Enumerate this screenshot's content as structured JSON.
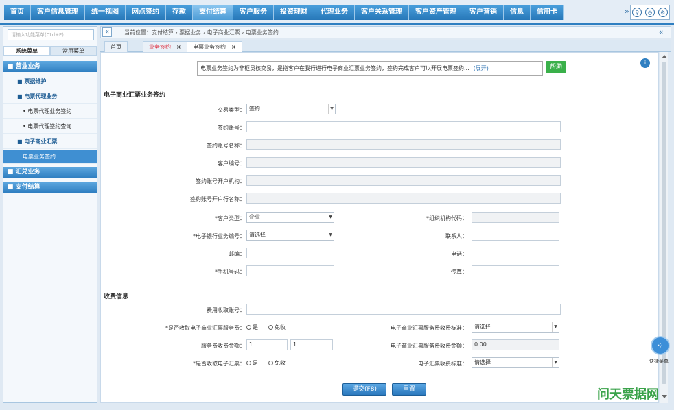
{
  "nav": {
    "items": [
      "首页",
      "客户信息管理",
      "统一视图",
      "网点签约",
      "存款",
      "支付结算",
      "客户服务",
      "投资理财",
      "代理业务",
      "客户关系管理",
      "客户资产管理",
      "客户营销",
      "信息",
      "信用卡"
    ],
    "more": "»",
    "icons": [
      "search-icon",
      "clock-icon",
      "gear-icon"
    ]
  },
  "sidebar": {
    "search_placeholder": "请输入功能菜单(Ctrl+F)",
    "tabs": [
      "系统菜单",
      "常用菜单"
    ],
    "sections": [
      {
        "label": "■ 营业业务"
      }
    ],
    "items": [
      {
        "label": "■ 票据维护",
        "level": "l1"
      },
      {
        "label": "■ 电票代理业务",
        "level": "l1"
      },
      {
        "label": "• 电票代理业务签约",
        "level": "l2"
      },
      {
        "label": "• 电票代理签约查询",
        "level": "l2"
      },
      {
        "label": "■ 电子商业汇票",
        "level": "l1"
      },
      {
        "label": "电票业务签约",
        "level": "l2",
        "active": true
      }
    ],
    "groups": [
      "■ 汇兑业务",
      "■ 支付结算"
    ]
  },
  "breadcrumb": {
    "text": "当前位置：支付结算 › 票据业务 › 电子商业汇票 › 电票业务签约",
    "left": "«",
    "right": "«"
  },
  "tabs": [
    {
      "label": "首页",
      "close": "",
      "style": ""
    },
    {
      "label": "业务签约",
      "close": "×",
      "style": "red"
    },
    {
      "label": "电票业务签约",
      "close": "×",
      "style": "active"
    }
  ],
  "notice": {
    "text": "电票业务签约为非柜员核交易，是指客户在我行进行电子商业汇票业务签约，签约完成客户可以开展电票签约...",
    "expand": "(展开)",
    "help": "帮助",
    "info": "i"
  },
  "form": {
    "section1": "电子商业汇票业务签约",
    "trade_type_label": "交易类型：",
    "trade_type_value": "签约",
    "acct_no_label": "签约账号：",
    "acct_name_label": "签约账号名称：",
    "cust_no_label": "客户编号：",
    "open_org_label": "签约账号开户机构：",
    "open_bank_label": "签约账号开户行名称：",
    "cust_type_label": "*客户类型：",
    "cust_type_value": "企业",
    "org_code_label": "*组织机构代码：",
    "bank_no_label": "*电子银行业务编号：",
    "bank_no_value": "请选择",
    "contact_label": "联系人：",
    "postcode_label": "邮编：",
    "phone_label": "电话：",
    "mobile_label": "*手机号码：",
    "fax_label": "传真：",
    "section2": "收费信息",
    "fee_acct_label": "费用收取账号：",
    "fee_flag_label": "*是否收取电子商业汇票服务费：",
    "radio_yes": "是",
    "radio_no": "免收",
    "fee_amount_label": "电子商业汇票服务费收费标准：",
    "fee_amount_value": "请选择",
    "fee_count_label": "服务费收费金额：",
    "fee_count_a": "1",
    "fee_count_b": "1",
    "fee_total_label": "电子商业汇票服务费收费金额：",
    "fee_total_value": "0.00",
    "fee_flag2_label": "*是否收取电子汇票：",
    "fee_std_label": "电子汇票收费标准：",
    "fee_std_value": "请选择",
    "submit": "提交(F8)",
    "reset": "重置"
  },
  "float_tool": {
    "icon": "⁘",
    "label": "快捷菜单"
  },
  "watermark": "问天票据网"
}
